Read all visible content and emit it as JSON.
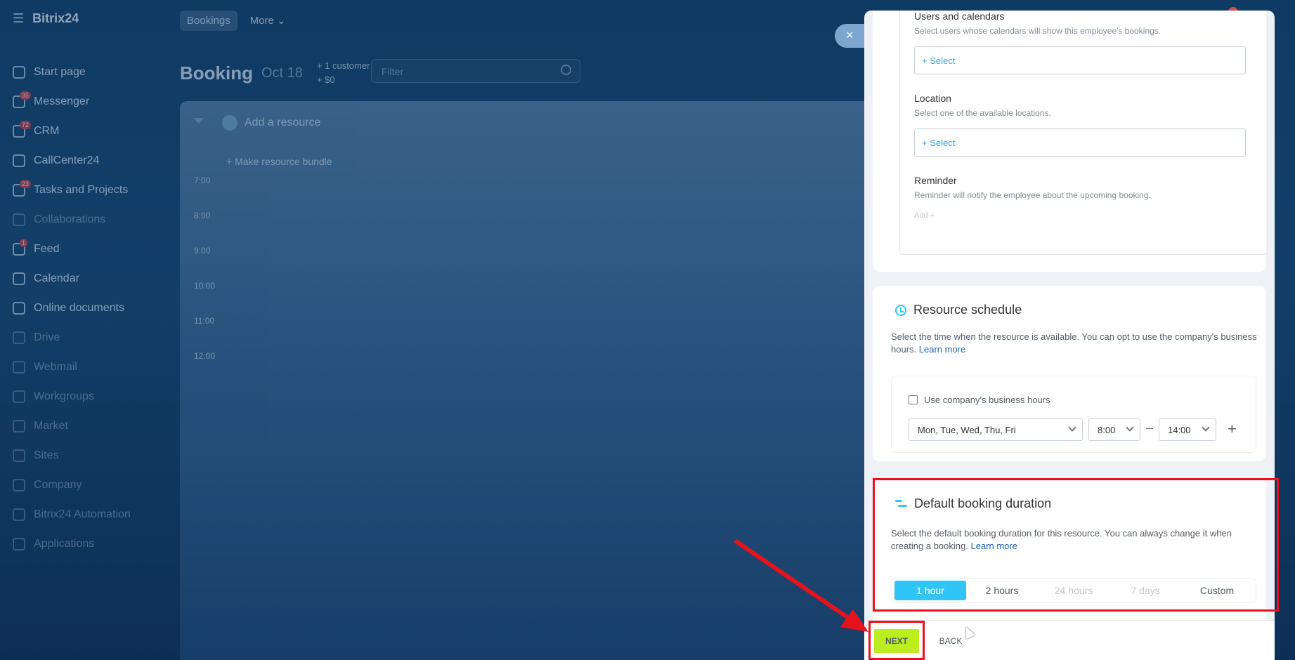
{
  "app": {
    "brand": "Bitrix24",
    "brand_mark": "©",
    "tabs": [
      {
        "label": "Bookings"
      },
      {
        "label": "More ⌄"
      }
    ],
    "sidebar": [
      {
        "label": "Start page",
        "badge": ""
      },
      {
        "label": "Messenger",
        "badge": "35"
      },
      {
        "label": "CRM",
        "badge": "72"
      },
      {
        "label": "CallCenter24",
        "badge": ""
      },
      {
        "label": "Tasks and Projects",
        "badge": "23"
      },
      {
        "label": "Collaborations",
        "badge": ""
      },
      {
        "label": "Feed",
        "badge": "1"
      },
      {
        "label": "Calendar",
        "badge": ""
      },
      {
        "label": "Online documents",
        "badge": ""
      },
      {
        "label": "Drive",
        "badge": ""
      },
      {
        "label": "Webmail",
        "badge": ""
      },
      {
        "label": "Workgroups",
        "badge": ""
      },
      {
        "label": "Market",
        "badge": ""
      },
      {
        "label": "Sites",
        "badge": ""
      },
      {
        "label": "Company",
        "badge": ""
      },
      {
        "label": "Bitrix24 Automation",
        "badge": ""
      },
      {
        "label": "Applications",
        "badge": ""
      }
    ],
    "header": {
      "title": "Booking",
      "date": "Oct 18",
      "customers": "+ 1 customer",
      "amount": "+ $0"
    },
    "filter": {
      "placeholder": "Filter"
    },
    "board": {
      "add_resource": "Add a resource",
      "bundle": "+ Make resource bundle",
      "times": [
        "7:00",
        "8:00",
        "9:00",
        "10:00",
        "11:00",
        "12:00"
      ]
    },
    "close_icon": "×"
  },
  "panel": {
    "users_calendars": {
      "title": "Users and calendars",
      "desc": "Select users whose calendars will show this employee's bookings.",
      "select": "+ Select"
    },
    "location": {
      "title": "Location",
      "desc": "Select one of the available locations.",
      "select": "+ Select"
    },
    "reminder": {
      "title": "Reminder",
      "desc": "Reminder will notify the employee about the upcoming booking.",
      "add": "Add +"
    },
    "resource_schedule": {
      "title": "Resource schedule",
      "desc": "Select the time when the resource is available. You can opt to use the company's business hours.",
      "learn_more": "Learn more",
      "checkbox_label": "Use company's business hours",
      "days": "Mon, Tue, Wed, Thu, Fri",
      "from": "8:00",
      "to": "14:00"
    },
    "default_duration": {
      "title": "Default booking duration",
      "desc": "Select the default booking duration for this resource. You can always change it when creating a booking.",
      "learn_more": "Learn more",
      "options": [
        {
          "label": "1 hour",
          "state": "active"
        },
        {
          "label": "2 hours",
          "state": "normal"
        },
        {
          "label": "24 hours",
          "state": "disabled"
        },
        {
          "label": "7 days",
          "state": "disabled"
        },
        {
          "label": "Custom",
          "state": "normal"
        }
      ]
    },
    "footer": {
      "next": "NEXT",
      "back": "BACK"
    }
  },
  "colors": {
    "accent": "#2fc6f6",
    "next": "#bbed21",
    "highlight": "#e8121c"
  }
}
